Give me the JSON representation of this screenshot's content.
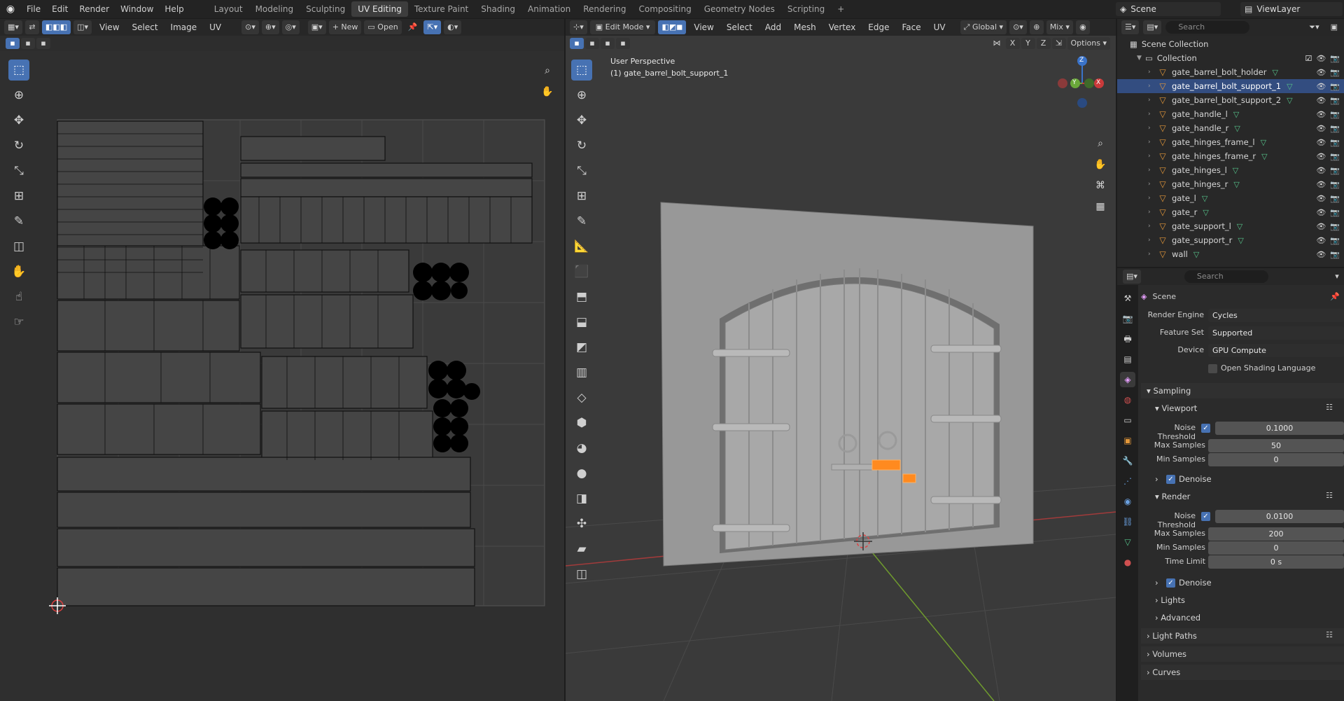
{
  "topbar": {
    "menus": [
      "File",
      "Edit",
      "Render",
      "Window",
      "Help"
    ],
    "workspaces": [
      "Layout",
      "Modeling",
      "Sculpting",
      "UV Editing",
      "Texture Paint",
      "Shading",
      "Animation",
      "Rendering",
      "Compositing",
      "Geometry Nodes",
      "Scripting"
    ],
    "active_workspace": "UV Editing",
    "add_workspace": "+",
    "scene_name": "Scene",
    "view_layer": "ViewLayer"
  },
  "uv_editor": {
    "menus": [
      "View",
      "Select",
      "Image",
      "UV"
    ],
    "new_label": "New",
    "open_label": "Open"
  },
  "viewport": {
    "mode": "Edit Mode",
    "menus": [
      "View",
      "Select",
      "Add",
      "Mesh",
      "Vertex",
      "Edge",
      "Face",
      "UV"
    ],
    "transform_orientation": "Global",
    "shading_mix": "Mix",
    "axis_buttons": [
      "X",
      "Y",
      "Z"
    ],
    "options_label": "Options",
    "perspective_label": "User Perspective",
    "active_object_label": "(1) gate_barrel_bolt_support_1",
    "gizmo_axes": [
      "Z",
      "Y",
      "X"
    ]
  },
  "outliner": {
    "search_placeholder": "Search",
    "root": "Scene Collection",
    "collection": "Collection",
    "items": [
      {
        "name": "gate_barrel_bolt_holder",
        "selected": false
      },
      {
        "name": "gate_barrel_bolt_support_1",
        "selected": true
      },
      {
        "name": "gate_barrel_bolt_support_2",
        "selected": false
      },
      {
        "name": "gate_handle_l",
        "selected": false
      },
      {
        "name": "gate_handle_r",
        "selected": false
      },
      {
        "name": "gate_hinges_frame_l",
        "selected": false
      },
      {
        "name": "gate_hinges_frame_r",
        "selected": false
      },
      {
        "name": "gate_hinges_l",
        "selected": false
      },
      {
        "name": "gate_hinges_r",
        "selected": false
      },
      {
        "name": "gate_l",
        "selected": false
      },
      {
        "name": "gate_r",
        "selected": false
      },
      {
        "name": "gate_support_l",
        "selected": false
      },
      {
        "name": "gate_support_r",
        "selected": false
      },
      {
        "name": "wall",
        "selected": false
      }
    ]
  },
  "properties": {
    "search_placeholder": "Search",
    "context": "Scene",
    "render_engine_label": "Render Engine",
    "render_engine": "Cycles",
    "feature_set_label": "Feature Set",
    "feature_set": "Supported",
    "device_label": "Device",
    "device": "GPU Compute",
    "osl_label": "Open Shading Language",
    "sampling": "Sampling",
    "viewport": "Viewport",
    "render": "Render",
    "noise_threshold_label": "Noise Threshold",
    "max_samples_label": "Max Samples",
    "min_samples_label": "Min Samples",
    "time_limit_label": "Time Limit",
    "denoise_label": "Denoise",
    "viewport_noise_threshold": "0.1000",
    "viewport_max_samples": "50",
    "viewport_min_samples": "0",
    "render_noise_threshold": "0.0100",
    "render_max_samples": "200",
    "render_min_samples": "0",
    "render_time_limit": "0 s",
    "lights": "Lights",
    "advanced": "Advanced",
    "light_paths": "Light Paths",
    "volumes": "Volumes",
    "curves": "Curves"
  },
  "colors": {
    "accent": "#4772b3",
    "selected_row": "#334d80",
    "object_orange": "#e4983a",
    "mesh_green": "#56c28a",
    "selection_orange": "#ff8a1f"
  }
}
